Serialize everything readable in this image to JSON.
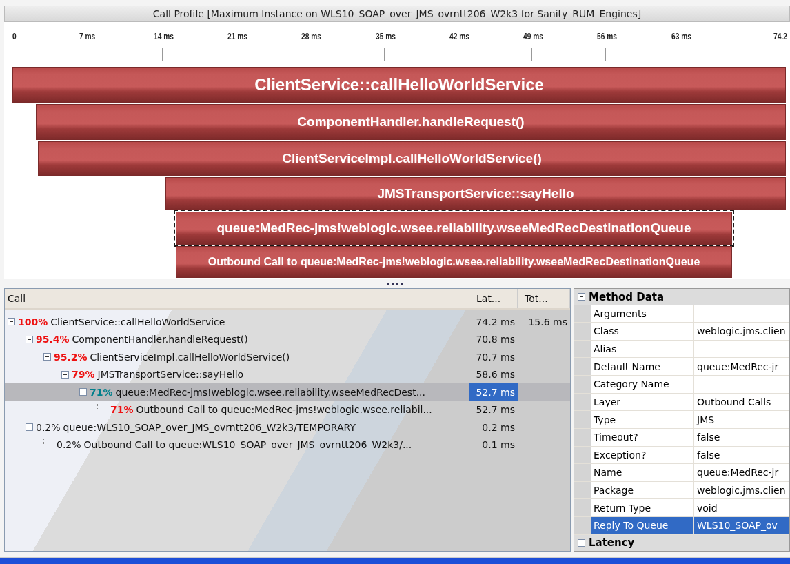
{
  "window": {
    "title": "Call Profile [Maximum Instance on WLS10_SOAP_over_JMS_ovrntt206_W2k3 for Sanity_RUM_Engines]"
  },
  "ruler": {
    "ticks": [
      "0",
      "7 ms",
      "14 ms",
      "21 ms",
      "28 ms",
      "35 ms",
      "42 ms",
      "49 ms",
      "56 ms",
      "63 ms",
      "74.2"
    ]
  },
  "flame_bars": [
    {
      "label": "ClientService::callHelloWorldService",
      "selected": false
    },
    {
      "label": "ComponentHandler.handleRequest()",
      "selected": false
    },
    {
      "label": "ClientServiceImpl.callHelloWorldService()",
      "selected": false
    },
    {
      "label": "JMSTransportService::sayHello",
      "selected": false
    },
    {
      "label": "queue:MedRec-jms!weblogic.wsee.reliability.wseeMedRecDestinationQueue",
      "selected": true
    },
    {
      "label": "Outbound Call to queue:MedRec-jms!weblogic.wsee.reliability.wseeMedRecDestinationQueue",
      "selected": false
    }
  ],
  "call_tree": {
    "columns": [
      "Call",
      "Lat...",
      "Tot..."
    ],
    "rows": [
      {
        "percent": "100%",
        "hot": true,
        "name": "ClientService::callHelloWorldService",
        "latency": "74.2 ms",
        "total": "15.6 ms",
        "selected": false,
        "expanded": true,
        "children": [
          {
            "percent": "95.4%",
            "hot": true,
            "name": "ComponentHandler.handleRequest()",
            "latency": "70.8 ms",
            "selected": false,
            "expanded": true,
            "children": [
              {
                "percent": "95.2%",
                "hot": true,
                "name": "ClientServiceImpl.callHelloWorldService()",
                "latency": "70.7 ms",
                "selected": false,
                "expanded": true,
                "children": [
                  {
                    "percent": "79%",
                    "hot": true,
                    "name": "JMSTransportService::sayHello",
                    "latency": "58.6 ms",
                    "selected": false,
                    "expanded": true,
                    "children": [
                      {
                        "percent": "71%",
                        "hot": true,
                        "name": "queue:MedRec-jms!weblogic.wsee.reliability.wseeMedRecDest...",
                        "latency": "52.7 ms",
                        "selected": true,
                        "expanded": true,
                        "children": [
                          {
                            "percent": "71%",
                            "hot": true,
                            "name": "Outbound Call to queue:MedRec-jms!weblogic.wsee.reliabil...",
                            "latency": "52.7 ms",
                            "selected": false
                          }
                        ]
                      }
                    ]
                  }
                ]
              }
            ]
          },
          {
            "percent": "0.2%",
            "hot": false,
            "name": "queue:WLS10_SOAP_over_JMS_ovrntt206_W2k3/TEMPORARY",
            "latency": "0.2 ms",
            "selected": false,
            "expanded": true,
            "children": [
              {
                "percent": "0.2%",
                "hot": false,
                "name": "Outbound Call to queue:WLS10_SOAP_over_JMS_ovrntt206_W2k3/...",
                "latency": "0.1 ms",
                "selected": false
              }
            ]
          }
        ]
      }
    ]
  },
  "properties": {
    "sections": [
      {
        "title": "Method Data",
        "expanded": true,
        "rows": [
          {
            "label": "Arguments",
            "selected": false
          },
          {
            "label": "Class",
            "value": "weblogic.jms.clien",
            "selected": false
          },
          {
            "label": "Alias",
            "selected": false
          },
          {
            "label": "Default Name",
            "value": "queue:MedRec-jr",
            "selected": false
          },
          {
            "label": "Category Name",
            "selected": false
          },
          {
            "label": "Layer",
            "value": "Outbound Calls",
            "selected": false
          },
          {
            "label": "Type",
            "value": "JMS",
            "selected": false
          },
          {
            "label": "Timeout?",
            "value": "false",
            "selected": false
          },
          {
            "label": "Exception?",
            "value": "false",
            "selected": false
          },
          {
            "label": "Name",
            "value": "queue:MedRec-jr",
            "selected": false
          },
          {
            "label": "Package",
            "value": "weblogic.jms.clien",
            "selected": false
          },
          {
            "label": "Return Type",
            "value": "void",
            "selected": false
          },
          {
            "label": "Reply To Queue",
            "value": "WLS10_SOAP_ov",
            "selected": true
          }
        ]
      },
      {
        "title": "Latency",
        "expanded": true
      }
    ]
  }
}
